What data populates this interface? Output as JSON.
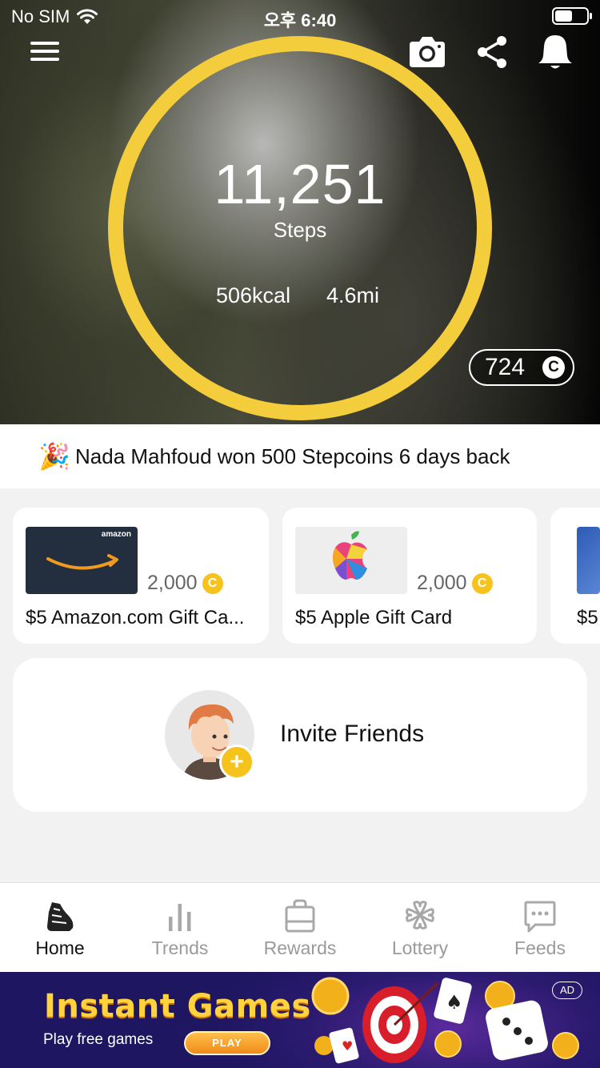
{
  "status_bar": {
    "carrier": "No SIM",
    "time": "오후 6:40",
    "battery_level": 0.55
  },
  "header": {
    "menu_icon": "hamburger-menu-icon",
    "camera_icon": "camera-icon",
    "share_icon": "share-icon",
    "notification_icon": "bell-icon"
  },
  "steps": {
    "value": "11,251",
    "label": "Steps",
    "kcal": "506kcal",
    "distance": "4.6mi"
  },
  "coins": {
    "balance": "724",
    "symbol": "C"
  },
  "ticker": {
    "emoji": "🎉",
    "message": "Nada Mahfoud won 500 Stepcoins 6 days back"
  },
  "rewards": [
    {
      "price": "2,000",
      "title": "$5 Amazon.com Gift Ca...",
      "thumb_text": "amazon"
    },
    {
      "price": "2,000",
      "title": "$5 Apple Gift Card"
    },
    {
      "title": "$5"
    }
  ],
  "coin_symbol": "C",
  "invite": {
    "label": "Invite Friends",
    "plus": "+"
  },
  "tabs": [
    {
      "label": "Home",
      "icon": "sneaker-icon",
      "active": true
    },
    {
      "label": "Trends",
      "icon": "bar-chart-icon"
    },
    {
      "label": "Rewards",
      "icon": "shopping-bag-icon"
    },
    {
      "label": "Lottery",
      "icon": "clover-icon"
    },
    {
      "label": "Feeds",
      "icon": "chat-bubble-icon"
    }
  ],
  "ad": {
    "headline": "Instant Games",
    "sub": "Play free games",
    "cta": "PLAY",
    "badge": "AD"
  },
  "colors": {
    "ring": "#f4cd3c",
    "coin": "#f6c21c",
    "accent_text": "#111111",
    "inactive_tab": "#9a9a9a"
  }
}
